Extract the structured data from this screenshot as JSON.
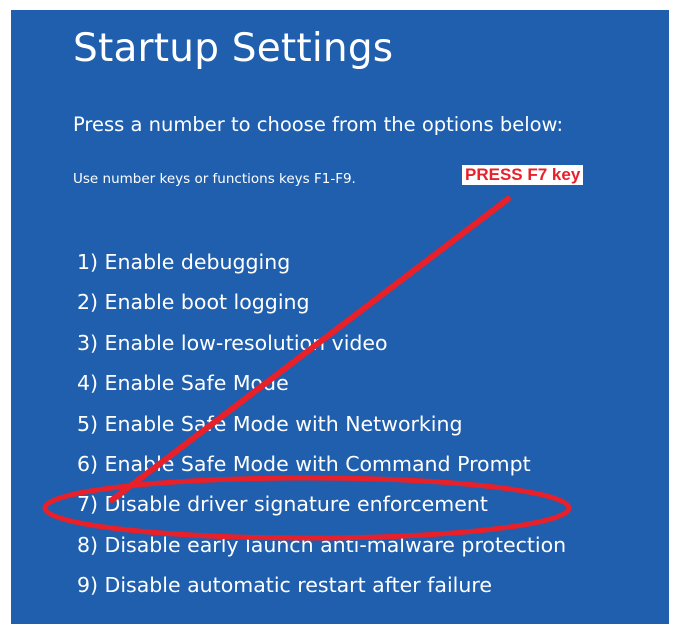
{
  "screen": {
    "title": "Startup Settings",
    "subtitle": "Press a number to choose from the options below:",
    "hint": "Use number keys or functions keys F1-F9."
  },
  "options": [
    {
      "label": "1) Enable debugging"
    },
    {
      "label": "2) Enable boot logging"
    },
    {
      "label": "3) Enable low-resolution video"
    },
    {
      "label": "4) Enable Safe Mode"
    },
    {
      "label": "5) Enable Safe Mode with Networking"
    },
    {
      "label": "6) Enable Safe Mode with Command Prompt"
    },
    {
      "label": "7) Disable driver signature enforcement"
    },
    {
      "label": "8) Disable early launch anti-malware protection"
    },
    {
      "label": "9) Disable automatic restart after failure"
    }
  ],
  "annotation": {
    "callout_text": "PRESS F7 key",
    "color": "#e8202a"
  },
  "colors": {
    "background": "#1f5fae",
    "text": "#ffffff"
  }
}
